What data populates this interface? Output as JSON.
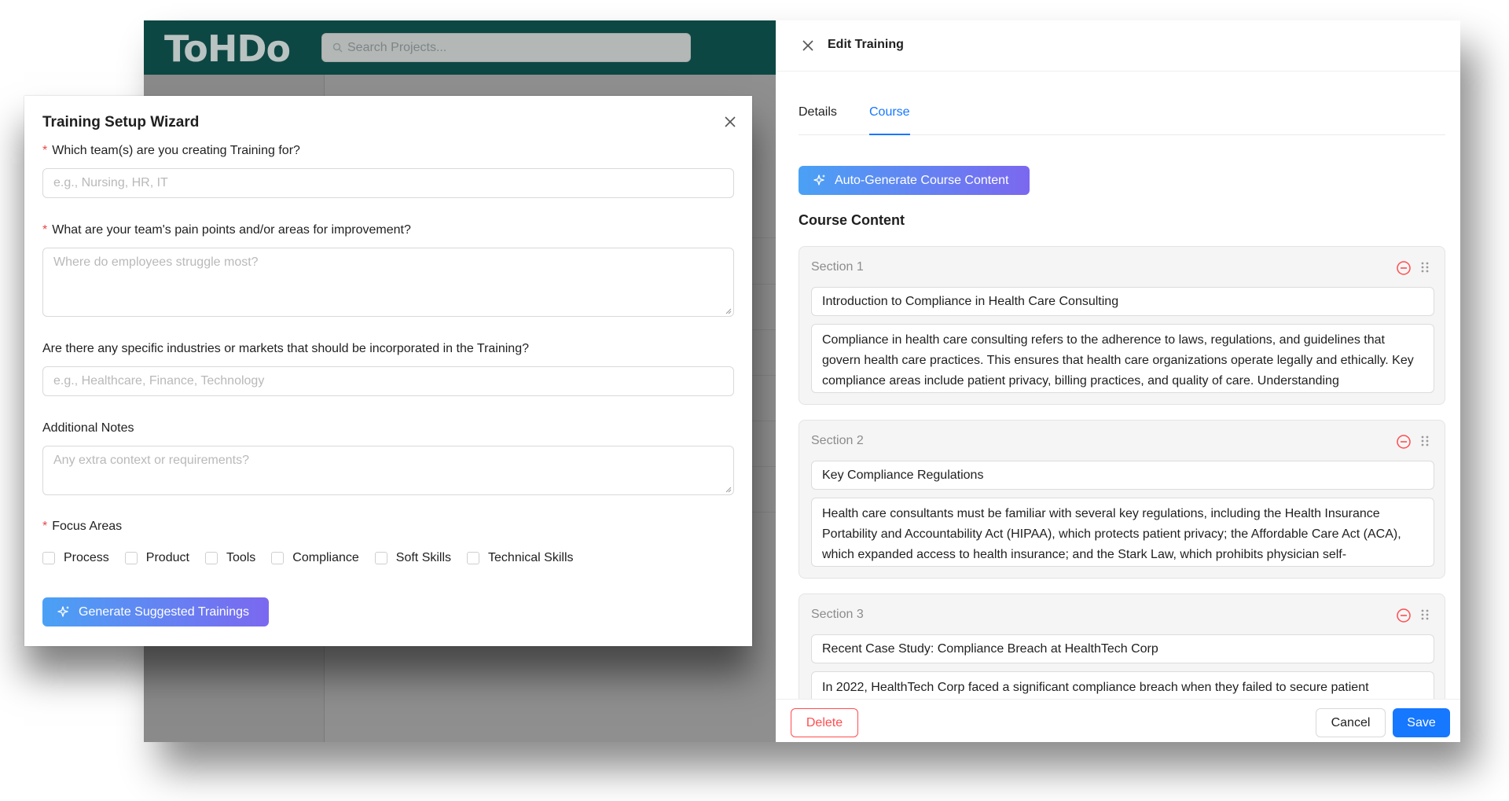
{
  "app": {
    "logo": "ToHDo",
    "search_placeholder": "Search Projects..."
  },
  "wizard": {
    "title": "Training Setup Wizard",
    "q1": {
      "label": "Which team(s) are you creating Training for?",
      "placeholder": "e.g., Nursing, HR, IT"
    },
    "q2": {
      "label": "What are your team's pain points and/or areas for improvement?",
      "placeholder": "Where do employees struggle most?"
    },
    "q3": {
      "label": "Are there any specific industries or markets that should be incorporated in the Training?",
      "placeholder": "e.g., Healthcare, Finance, Technology"
    },
    "q4": {
      "label": "Additional Notes",
      "placeholder": "Any extra context or requirements?"
    },
    "focus": {
      "label": "Focus Areas",
      "options": [
        "Process",
        "Product",
        "Tools",
        "Compliance",
        "Soft Skills",
        "Technical Skills"
      ]
    },
    "generate_label": "Generate Suggested Trainings"
  },
  "drawer": {
    "title": "Edit Training",
    "tabs": {
      "details": "Details",
      "course": "Course"
    },
    "auto_generate_label": "Auto-Generate Course Content",
    "content_title": "Course Content",
    "sections": [
      {
        "label": "Section 1",
        "title": "Introduction to Compliance in Health Care Consulting",
        "body": "Compliance in health care consulting refers to the adherence to laws, regulations, and guidelines that govern health care practices. This ensures that health care organizations operate legally and ethically. Key compliance areas include patient privacy, billing practices, and quality of care. Understanding"
      },
      {
        "label": "Section 2",
        "title": "Key Compliance Regulations",
        "body": "Health care consultants must be familiar with several key regulations, including the Health Insurance Portability and Accountability Act (HIPAA), which protects patient privacy; the Affordable Care Act (ACA), which expanded access to health insurance; and the Stark Law, which prohibits physician self-"
      },
      {
        "label": "Section 3",
        "title": "Recent Case Study: Compliance Breach at HealthTech Corp",
        "body": "In 2022, HealthTech Corp faced a significant compliance breach when they failed to secure patient"
      }
    ],
    "footer": {
      "delete": "Delete",
      "cancel": "Cancel",
      "save": "Save"
    }
  },
  "colors": {
    "header_bg": "#0d4743",
    "primary": "#1677ff",
    "danger": "#ff4d4f",
    "gradient_start": "#4aa1f5",
    "gradient_end": "#7b68f0"
  }
}
